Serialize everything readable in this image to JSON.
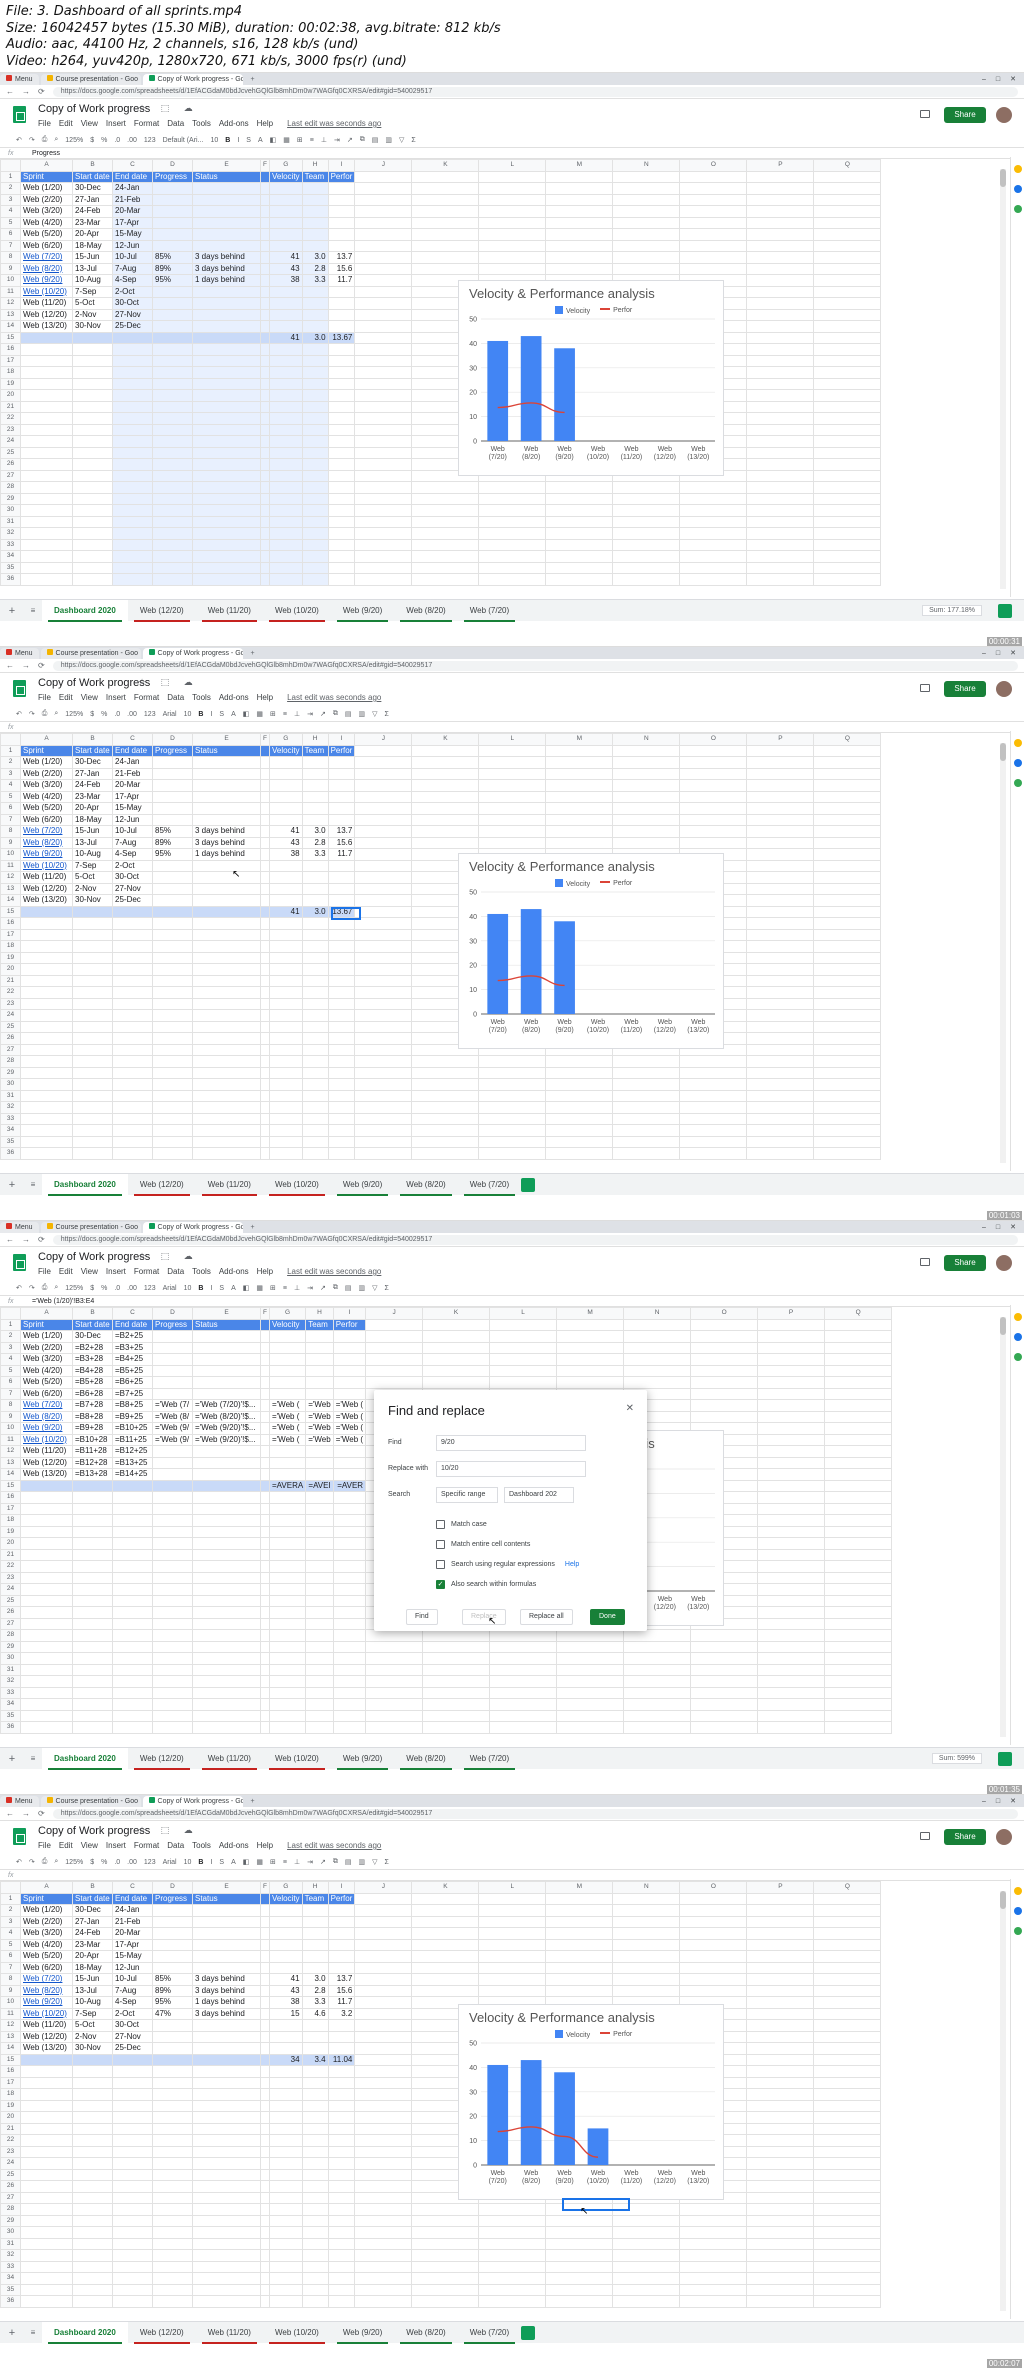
{
  "file_info": [
    "File: 3. Dashboard of all sprints.mp4",
    "Size: 16042457 bytes (15.30 MiB), duration: 00:02:38, avg.bitrate: 812 kb/s",
    "Audio: aac, 44100 Hz, 2 channels, s16, 128 kb/s (und)",
    "Video: h264, yuv420p, 1280x720, 671 kb/s, 3000 fps(r) (und)"
  ],
  "browser": {
    "tabs": [
      "Menu",
      "Course presentation - Goo",
      "Copy of Work progress - Goo"
    ],
    "url": "https://docs.google.com/spreadsheets/d/1EfACGdaM0bdJcvehGQlGlb8mhDm0w7WAGfq0CXRSA/edit#gid=540029517"
  },
  "app": {
    "title": "Copy of Work progress",
    "menus": [
      "File",
      "Edit",
      "View",
      "Insert",
      "Format",
      "Data",
      "Tools",
      "Add-ons",
      "Help"
    ],
    "last_edit": "Last edit was seconds ago",
    "share_label": "Share",
    "toolbar": {
      "zoom": "125%",
      "currency": "$",
      "percent": "%",
      "decimal": ".0",
      "decimal2": ".00",
      "format": "123",
      "font_default": "Default (Ari...",
      "font_arial": "Arial",
      "size": "10",
      "bold": "B",
      "italic": "I",
      "strike": "S",
      "underline": "A",
      "sigma": "Σ"
    },
    "fx_symbol": "fx"
  },
  "columns": [
    "A",
    "B",
    "C",
    "D",
    "E",
    "F",
    "G",
    "H",
    "I",
    "J",
    "K",
    "L",
    "M",
    "N",
    "O",
    "P",
    "Q"
  ],
  "row_numbers": [
    "1",
    "2",
    "3",
    "4",
    "5",
    "6",
    "7",
    "8",
    "9",
    "10",
    "11",
    "12",
    "13",
    "14",
    "15",
    "16",
    "17",
    "18",
    "19",
    "20",
    "21",
    "22",
    "23",
    "24",
    "25",
    "26",
    "27",
    "28",
    "29",
    "30",
    "31",
    "32",
    "33",
    "34",
    "35",
    "36"
  ],
  "frames": [
    {
      "fx_value": "Progress",
      "header": [
        "Sprint",
        "Start date",
        "End date",
        "Progress",
        "Status",
        "",
        "Velocity",
        "Team",
        "Perfor"
      ],
      "rows": [
        [
          "Web (1/20)",
          "30-Dec",
          "24-Jan",
          "",
          "",
          "",
          "",
          ""
        ],
        [
          "Web (2/20)",
          "27-Jan",
          "21-Feb",
          "",
          "",
          "",
          "",
          ""
        ],
        [
          "Web (3/20)",
          "24-Feb",
          "20-Mar",
          "",
          "",
          "",
          "",
          ""
        ],
        [
          "Web (4/20)",
          "23-Mar",
          "17-Apr",
          "",
          "",
          "",
          "",
          ""
        ],
        [
          "Web (5/20)",
          "20-Apr",
          "15-May",
          "",
          "",
          "",
          "",
          ""
        ],
        [
          "Web (6/20)",
          "18-May",
          "12-Jun",
          "",
          "",
          "",
          "",
          ""
        ],
        [
          "Web (7/20)",
          "15-Jun",
          "10-Jul",
          "85%",
          "3 days behind",
          "41",
          "3.0",
          "13.7"
        ],
        [
          "Web (8/20)",
          "13-Jul",
          "7-Aug",
          "89%",
          "3 days behind",
          "43",
          "2.8",
          "15.6"
        ],
        [
          "Web (9/20)",
          "10-Aug",
          "4-Sep",
          "95%",
          "1 days behind",
          "38",
          "3.3",
          "11.7"
        ],
        [
          "Web (10/20)",
          "7-Sep",
          "2-Oct",
          "",
          "",
          "",
          "",
          ""
        ],
        [
          "Web (11/20)",
          "5-Oct",
          "30-Oct",
          "",
          "",
          "",
          "",
          ""
        ],
        [
          "Web (12/20)",
          "2-Nov",
          "27-Nov",
          "",
          "",
          "",
          "",
          ""
        ],
        [
          "Web (13/20)",
          "30-Nov",
          "25-Dec",
          "",
          "",
          "",
          "",
          ""
        ]
      ],
      "total": [
        "41",
        "3.0",
        "13.67"
      ],
      "tabs": [
        "Dashboard 2020",
        "Web (12/20)",
        "Web (11/20)",
        "Web (10/20)",
        "Web (9/20)",
        "Web (8/20)",
        "Web (7/20)"
      ],
      "sum_label": "Sum: 177.18%",
      "timestamp": "00:00:31"
    },
    {
      "fx_value": "",
      "header": [
        "Sprint",
        "Start date",
        "End date",
        "Progress",
        "Status",
        "",
        "Velocity",
        "Team",
        "Perfor"
      ],
      "rows": [
        [
          "Web (1/20)",
          "30-Dec",
          "24-Jan",
          "",
          "",
          "",
          "",
          ""
        ],
        [
          "Web (2/20)",
          "27-Jan",
          "21-Feb",
          "",
          "",
          "",
          "",
          ""
        ],
        [
          "Web (3/20)",
          "24-Feb",
          "20-Mar",
          "",
          "",
          "",
          "",
          ""
        ],
        [
          "Web (4/20)",
          "23-Mar",
          "17-Apr",
          "",
          "",
          "",
          "",
          ""
        ],
        [
          "Web (5/20)",
          "20-Apr",
          "15-May",
          "",
          "",
          "",
          "",
          ""
        ],
        [
          "Web (6/20)",
          "18-May",
          "12-Jun",
          "",
          "",
          "",
          "",
          ""
        ],
        [
          "Web (7/20)",
          "15-Jun",
          "10-Jul",
          "85%",
          "3 days behind",
          "41",
          "3.0",
          "13.7"
        ],
        [
          "Web (8/20)",
          "13-Jul",
          "7-Aug",
          "89%",
          "3 days behind",
          "43",
          "2.8",
          "15.6"
        ],
        [
          "Web (9/20)",
          "10-Aug",
          "4-Sep",
          "95%",
          "1 days behind",
          "38",
          "3.3",
          "11.7"
        ],
        [
          "Web (10/20)",
          "7-Sep",
          "2-Oct",
          "",
          "",
          "",
          "",
          ""
        ],
        [
          "Web (11/20)",
          "5-Oct",
          "30-Oct",
          "",
          "",
          "",
          "",
          ""
        ],
        [
          "Web (12/20)",
          "2-Nov",
          "27-Nov",
          "",
          "",
          "",
          "",
          ""
        ],
        [
          "Web (13/20)",
          "30-Nov",
          "25-Dec",
          "",
          "",
          "",
          "",
          ""
        ]
      ],
      "total": [
        "41",
        "3.0",
        "13.67"
      ],
      "tabs": [
        "Dashboard 2020",
        "Web (12/20)",
        "Web (11/20)",
        "Web (10/20)",
        "Web (9/20)",
        "Web (8/20)",
        "Web (7/20)"
      ],
      "sum_label": "",
      "timestamp": "00:01:03"
    },
    {
      "fx_value": "='Web (1/20)'!B3:E4",
      "header": [
        "Sprint",
        "Start date",
        "End date",
        "Progress",
        "Status",
        "",
        "Velocity",
        "Team",
        "Perfor"
      ],
      "rows": [
        [
          "Web (1/20)",
          "30-Dec",
          "=B2+25",
          "",
          "",
          "",
          "",
          ""
        ],
        [
          "Web (2/20)",
          "=B2+28",
          "=B3+25",
          "",
          "",
          "",
          "",
          ""
        ],
        [
          "Web (3/20)",
          "=B3+28",
          "=B4+25",
          "",
          "",
          "",
          "",
          ""
        ],
        [
          "Web (4/20)",
          "=B4+28",
          "=B5+25",
          "",
          "",
          "",
          "",
          ""
        ],
        [
          "Web (5/20)",
          "=B5+28",
          "=B6+25",
          "",
          "",
          "",
          "",
          ""
        ],
        [
          "Web (6/20)",
          "=B6+28",
          "=B7+25",
          "",
          "",
          "",
          "",
          ""
        ],
        [
          "Web (7/20)",
          "=B7+28",
          "=B8+25",
          "='Web (7/",
          "='Web (7/20)'!$...",
          "='Web (",
          "='Web",
          "='Web ("
        ],
        [
          "Web (8/20)",
          "=B8+28",
          "=B9+25",
          "='Web (8/",
          "='Web (8/20)'!$...",
          "='Web (",
          "='Web",
          "='Web ("
        ],
        [
          "Web (9/20)",
          "=B9+28",
          "=B10+25",
          "='Web (9/",
          "='Web (9/20)'!$...",
          "='Web (",
          "='Web",
          "='Web ("
        ],
        [
          "Web (10/20)",
          "=B10+28",
          "=B11+25",
          "='Web (9/",
          "='Web (9/20)'!$...",
          "='Web (",
          "='Web",
          "='Web ("
        ],
        [
          "Web (11/20)",
          "=B11+28",
          "=B12+25",
          "",
          "",
          "",
          "",
          ""
        ],
        [
          "Web (12/20)",
          "=B12+28",
          "=B13+25",
          "",
          "",
          "",
          "",
          ""
        ],
        [
          "Web (13/20)",
          "=B13+28",
          "=B14+25",
          "",
          "",
          "",
          "",
          ""
        ]
      ],
      "total": [
        "=AVERA",
        "=AVEI",
        "=AVER"
      ],
      "tabs": [
        "Dashboard 2020",
        "Web (12/20)",
        "Web (11/20)",
        "Web (10/20)",
        "Web (9/20)",
        "Web (8/20)",
        "Web (7/20)"
      ],
      "sum_label": "Sum: 599%",
      "timestamp": "00:01:35"
    },
    {
      "fx_value": "",
      "header": [
        "Sprint",
        "Start date",
        "End date",
        "Progress",
        "Status",
        "",
        "Velocity",
        "Team",
        "Perfor"
      ],
      "rows": [
        [
          "Web (1/20)",
          "30-Dec",
          "24-Jan",
          "",
          "",
          "",
          "",
          ""
        ],
        [
          "Web (2/20)",
          "27-Jan",
          "21-Feb",
          "",
          "",
          "",
          "",
          ""
        ],
        [
          "Web (3/20)",
          "24-Feb",
          "20-Mar",
          "",
          "",
          "",
          "",
          ""
        ],
        [
          "Web (4/20)",
          "23-Mar",
          "17-Apr",
          "",
          "",
          "",
          "",
          ""
        ],
        [
          "Web (5/20)",
          "20-Apr",
          "15-May",
          "",
          "",
          "",
          "",
          ""
        ],
        [
          "Web (6/20)",
          "18-May",
          "12-Jun",
          "",
          "",
          "",
          "",
          ""
        ],
        [
          "Web (7/20)",
          "15-Jun",
          "10-Jul",
          "85%",
          "3 days behind",
          "41",
          "3.0",
          "13.7"
        ],
        [
          "Web (8/20)",
          "13-Jul",
          "7-Aug",
          "89%",
          "3 days behind",
          "43",
          "2.8",
          "15.6"
        ],
        [
          "Web (9/20)",
          "10-Aug",
          "4-Sep",
          "95%",
          "1 days behind",
          "38",
          "3.3",
          "11.7"
        ],
        [
          "Web (10/20)",
          "7-Sep",
          "2-Oct",
          "47%",
          "3 days behind",
          "15",
          "4.6",
          "3.2"
        ],
        [
          "Web (11/20)",
          "5-Oct",
          "30-Oct",
          "",
          "",
          "",
          "",
          ""
        ],
        [
          "Web (12/20)",
          "2-Nov",
          "27-Nov",
          "",
          "",
          "",
          "",
          ""
        ],
        [
          "Web (13/20)",
          "30-Nov",
          "25-Dec",
          "",
          "",
          "",
          "",
          ""
        ]
      ],
      "total": [
        "34",
        "3.4",
        "11.04"
      ],
      "tabs": [
        "Dashboard 2020",
        "Web (12/20)",
        "Web (11/20)",
        "Web (10/20)",
        "Web (9/20)",
        "Web (8/20)",
        "Web (7/20)"
      ],
      "sum_label": "",
      "timestamp": "00:02:07"
    }
  ],
  "dialog": {
    "title": "Find and replace",
    "find_label": "Find",
    "find_value": "9/20",
    "replace_label": "Replace with",
    "replace_value": "10/20",
    "search_label": "Search",
    "search_scope": "Specific range",
    "search_range": "Dashboard 202",
    "options": [
      "Match case",
      "Match entire cell contents",
      "Search using regular expressions",
      "Also search within formulas"
    ],
    "help": "Help",
    "btn_find": "Find",
    "btn_replace": "Replace",
    "btn_replace_all": "Replace all",
    "btn_done": "Done"
  },
  "chart_data": [
    {
      "type": "bar",
      "title": "Velocity & Performance analysis",
      "categories": [
        "Web (7/20)",
        "Web (8/20)",
        "Web (9/20)",
        "Web (10/20)",
        "Web (11/20)",
        "Web (12/20)",
        "Web (13/20)"
      ],
      "series": [
        {
          "name": "Velocity",
          "kind": "bar",
          "color": "#4285f4",
          "values": [
            41,
            43,
            38,
            null,
            null,
            null,
            null
          ]
        },
        {
          "name": "Perfor",
          "kind": "line",
          "color": "#db4437",
          "values": [
            13.7,
            15.6,
            11.7,
            null,
            null,
            null,
            null
          ]
        }
      ],
      "ylim": [
        0,
        50
      ],
      "yticks": [
        0,
        10,
        20,
        30,
        40,
        50
      ],
      "grid": true,
      "legend": "top"
    },
    {
      "type": "bar",
      "title": "Velocity & Performance analysis",
      "categories": [
        "Web (7/20)",
        "Web (8/20)",
        "Web (9/20)",
        "Web (10/20)",
        "Web (11/20)",
        "Web (12/20)",
        "Web (13/20)"
      ],
      "series": [
        {
          "name": "Velocity",
          "kind": "bar",
          "color": "#4285f4",
          "values": [
            41,
            43,
            38,
            null,
            null,
            null,
            null
          ]
        },
        {
          "name": "Perfor",
          "kind": "line",
          "color": "#db4437",
          "values": [
            13.7,
            15.6,
            11.7,
            null,
            null,
            null,
            null
          ]
        }
      ],
      "ylim": [
        0,
        50
      ],
      "yticks": [
        0,
        10,
        20,
        30,
        40,
        50
      ],
      "grid": true,
      "legend": "top"
    },
    {
      "type": "bar",
      "title": "Velocity & Performance analysis",
      "categories": [
        "Web (7/20)",
        "Web (8/20)",
        "Web (9/20)",
        "Web (10/20)",
        "Web (11/20)",
        "Web (12/20)",
        "Web (13/20)"
      ],
      "series": [
        {
          "name": "Velocity",
          "kind": "bar",
          "color": "#4285f4",
          "values": [
            null,
            null,
            null,
            null,
            null,
            null,
            null
          ]
        },
        {
          "name": "Perfor",
          "kind": "line",
          "color": "#db4437",
          "values": [
            null,
            null,
            null,
            null,
            null,
            null,
            null
          ]
        }
      ],
      "ylim": [
        0,
        50
      ],
      "yticks": [],
      "grid": true,
      "legend": "top"
    },
    {
      "type": "bar",
      "title": "Velocity & Performance analysis",
      "categories": [
        "Web (7/20)",
        "Web (8/20)",
        "Web (9/20)",
        "Web (10/20)",
        "Web (11/20)",
        "Web (12/20)",
        "Web (13/20)"
      ],
      "series": [
        {
          "name": "Velocity",
          "kind": "bar",
          "color": "#4285f4",
          "values": [
            41,
            43,
            38,
            15,
            null,
            null,
            null
          ]
        },
        {
          "name": "Perfor",
          "kind": "line",
          "color": "#db4437",
          "values": [
            13.7,
            15.6,
            11.7,
            3.2,
            null,
            null,
            null
          ]
        }
      ],
      "ylim": [
        0,
        50
      ],
      "yticks": [
        0,
        10,
        20,
        30,
        40,
        50
      ],
      "grid": true,
      "legend": "top"
    }
  ]
}
